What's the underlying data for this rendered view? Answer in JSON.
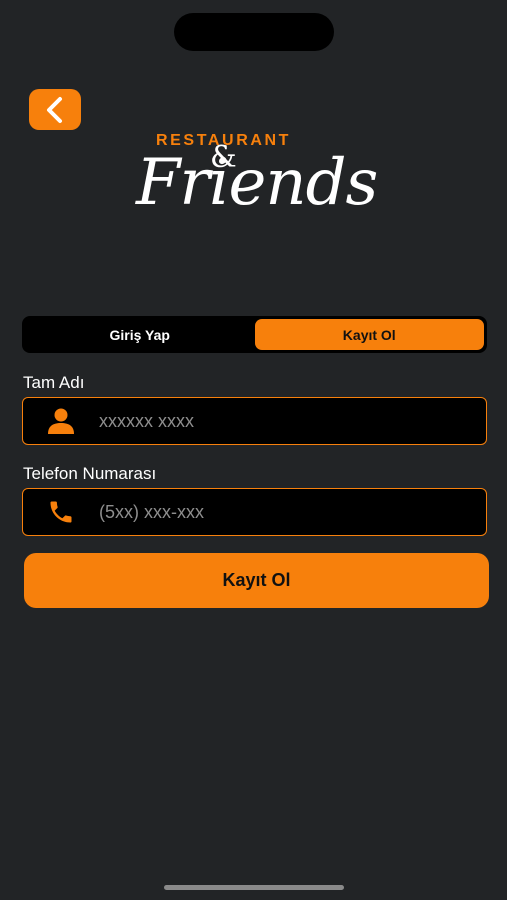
{
  "logo": {
    "restaurant_text": "RESTAURANT",
    "ampersand_text": "&",
    "friends_text": "Friends"
  },
  "tabs": [
    {
      "label": "Giriş Yap",
      "active": false
    },
    {
      "label": "Kayıt Ol",
      "active": true
    }
  ],
  "form": {
    "name_label": "Tam Adı",
    "name_placeholder": "xxxxxx xxxx",
    "name_value": "",
    "name_icon": "user-icon",
    "phone_label": "Telefon Numarası",
    "phone_placeholder": "(5xx) xxx-xxx",
    "phone_value": "",
    "phone_icon": "phone-icon",
    "submit_label": "Kayıt Ol"
  },
  "colors": {
    "accent": "#f7800c",
    "background": "#222426",
    "field_background": "#000000"
  }
}
